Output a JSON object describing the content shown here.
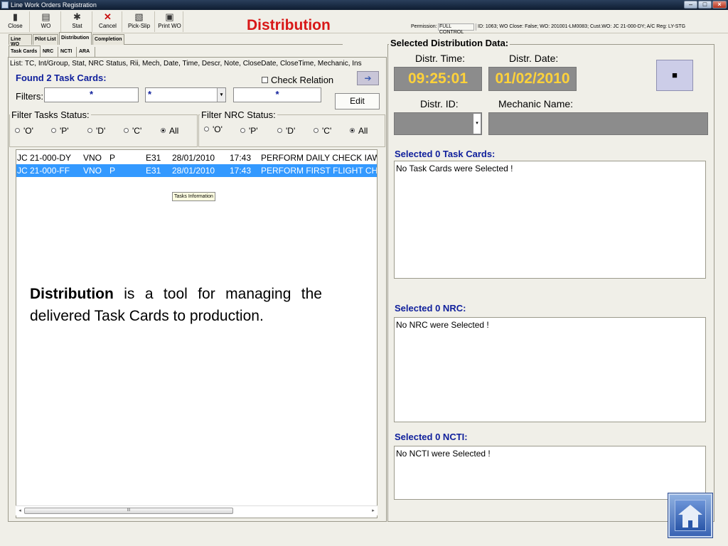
{
  "window": {
    "title": "Line Work Orders Registration"
  },
  "toolbar": {
    "buttons": [
      {
        "label": "Close",
        "icon": "door-icon"
      },
      {
        "label": "WO",
        "icon": "folder-icon"
      },
      {
        "label": "Stat",
        "icon": "gear-icon"
      },
      {
        "label": "Cancel",
        "icon": "x-icon"
      },
      {
        "label": "Pick-Slip",
        "icon": "document-icon"
      },
      {
        "label": "Print WO",
        "icon": "printer-icon"
      }
    ]
  },
  "heading": "Distribution",
  "permission": {
    "label": "Permission:",
    "value": "FULL CONTROL",
    "info": "ID: 1063; WO Close: False; WO: 201001-LM0083; Cust.WO: JC 21-000-DY; A/C Reg: LY-STG"
  },
  "main_tabs": [
    "Line WO",
    "Pilot List",
    "Distribution",
    "Completion"
  ],
  "sub_tabs": [
    "Task Cards",
    "NRC",
    "NCTI",
    "ARA"
  ],
  "left": {
    "list_columns": "List: TC, Int/Group, Stat, NRC Status, Rii, Mech, Date, Time, Descr, Note, CloseDate, CloseTime, Mechanic, Ins",
    "found_label": "Found 2 Task Cards:",
    "check_relation": "Check Relation",
    "filters_label": "Filters:",
    "filter_values": [
      "*",
      "*",
      "*"
    ],
    "edit_label": "Edit",
    "filter_tasks_title": "Filter Tasks Status:",
    "filter_nrc_title": "Filter NRC Status:",
    "status_options": [
      "'O'",
      "'P'",
      "'D'",
      "'C'",
      "All"
    ],
    "selected_status": "All",
    "rows": [
      {
        "tc": "JC 21-000-DY",
        "group": "VNO",
        "stat": "P",
        "mech": "E31",
        "date": "28/01/2010",
        "time": "17:43",
        "descr": "PERFORM DAILY CHECK IAW",
        "selected": false
      },
      {
        "tc": "JC 21-000-FF",
        "group": "VNO",
        "stat": "P",
        "mech": "E31",
        "date": "28/01/2010",
        "time": "17:43",
        "descr": "PERFORM FIRST FLIGHT CHECK",
        "selected": true
      }
    ],
    "tooltip": "Tasks Information",
    "scroll_grip": "III"
  },
  "overlay": {
    "bold": "Distribution",
    "rest": " is a tool for managing the delivered Task Cards to production."
  },
  "right": {
    "title": "Selected Distribution Data:",
    "distr_time_label": "Distr. Time:",
    "distr_date_label": "Distr. Date:",
    "distr_time": "09:25:01",
    "distr_date": "01/02/2010",
    "distr_id_label": "Distr. ID:",
    "mechanic_name_label": "Mechanic Name:",
    "sections": [
      {
        "title": "Selected 0 Task Cards:",
        "text": "No Task Cards were Selected !"
      },
      {
        "title": "Selected 0 NRC:",
        "text": "No NRC were Selected !"
      },
      {
        "title": "Selected 0 NCTI:",
        "text": "No NCTI were Selected !"
      }
    ]
  },
  "colors": {
    "heading": "#d81818",
    "accent_blue": "#10209c",
    "selection": "#3399ff",
    "time_value": "#ffd23a"
  }
}
